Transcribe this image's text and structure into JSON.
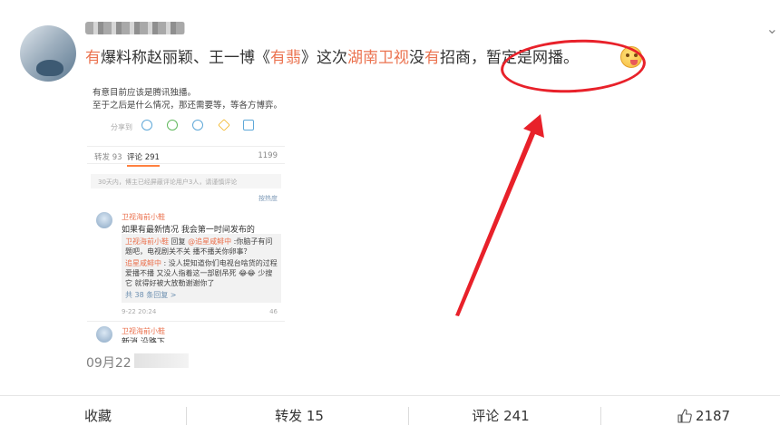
{
  "post": {
    "text_segments": [
      {
        "text": "有",
        "highlight": true
      },
      {
        "text": "爆料称赵丽颖、王一博《",
        "highlight": false
      },
      {
        "text": "有翡",
        "highlight": true
      },
      {
        "text": "》这次",
        "highlight": false
      },
      {
        "text": "湖南卫视",
        "highlight": true
      },
      {
        "text": "没",
        "highlight": false
      },
      {
        "text": "有",
        "highlight": true
      },
      {
        "text": "招商，暂定是网播。",
        "highlight": false
      }
    ],
    "emoji_icon": "yummy-face-emoji",
    "timestamp": "09月22"
  },
  "embedded_screenshot": {
    "line1": "有意目前应该是腾讯独播。",
    "line2": "至于之后是什么情况，那还需要等，等各方博弈。",
    "share_label": "分享到",
    "tab_repost": "转发 93",
    "tab_comments": "评论 291",
    "tab_likes": "1199",
    "notice": "30天内，博主已经屏蔽评论用户3人，请谨慎评论",
    "sort_label": "按热度",
    "comment1": {
      "name": "卫视海前小鞋",
      "text": "如果有最新情况 我会第一时间发布的",
      "reply1_user": "卫视海前小鞋",
      "reply1_mid": "回复",
      "reply1_to": "@追星咸鲱中",
      "reply1_text": ":你脑子有问题吧，电视剧关不关 播不播关你卵事？",
      "reply2_user": "追星咸鲱中",
      "reply2_text": ": 没人提知道你们电视台啥货的过程 爱播不播 又没人指着这一部剧吊死 😂😂 少搜它 就得好被大放勒谢谢你了",
      "more_replies": "共 38 条回复 >",
      "time": "9-22 20:24",
      "likes": "46"
    },
    "comment2": {
      "name": "卫视海前小鞋",
      "text": "新消 沿路下"
    }
  },
  "actions": {
    "favorite": "收藏",
    "repost": "转发 15",
    "comment": "评论 241",
    "like_count": "2187",
    "like_icon": "thumbs-up-icon"
  },
  "colors": {
    "highlight": "#eb7350",
    "annotation_red": "#e8212a"
  }
}
